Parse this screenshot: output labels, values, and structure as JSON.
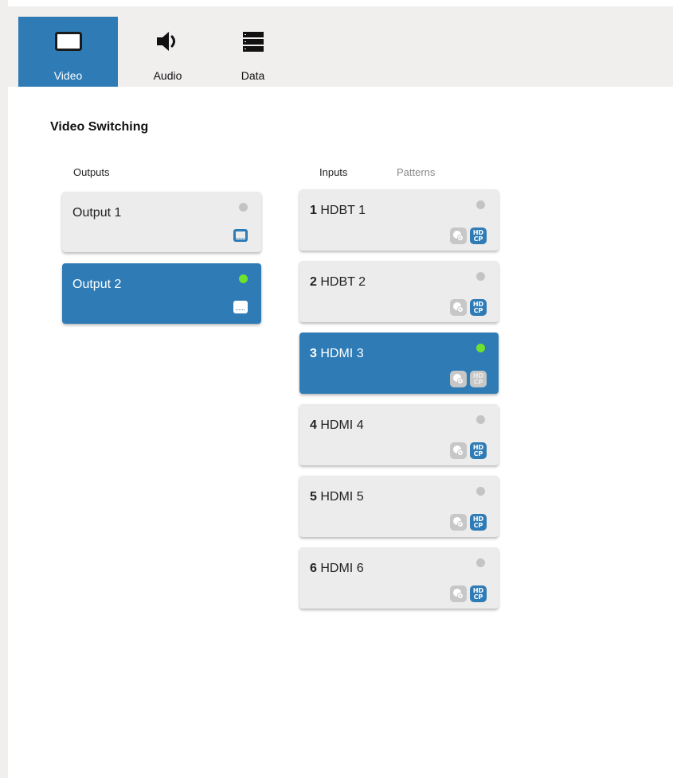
{
  "tabs": [
    {
      "label": "Video",
      "icon": "monitor-icon",
      "active": true
    },
    {
      "label": "Audio",
      "icon": "speaker-icon",
      "active": false
    },
    {
      "label": "Data",
      "icon": "server-icon",
      "active": false
    }
  ],
  "section_title": "Video Switching",
  "outputs_header": "Outputs",
  "inputs_header": "Inputs",
  "patterns_header": "Patterns",
  "outputs": [
    {
      "label": "Output 1",
      "signal": false,
      "selected": false
    },
    {
      "label": "Output 2",
      "signal": true,
      "selected": true
    }
  ],
  "inputs": [
    {
      "num": "1",
      "name": "HDBT 1",
      "signal": false,
      "selected": false
    },
    {
      "num": "2",
      "name": "HDBT 2",
      "signal": false,
      "selected": false
    },
    {
      "num": "3",
      "name": "HDMI 3",
      "signal": true,
      "selected": true
    },
    {
      "num": "4",
      "name": "HDMI 4",
      "signal": false,
      "selected": false
    },
    {
      "num": "5",
      "name": "HDMI 5",
      "signal": false,
      "selected": false
    },
    {
      "num": "6",
      "name": "HDMI 6",
      "signal": false,
      "selected": false
    }
  ],
  "hdcp_badge_text": [
    "HD",
    "CP"
  ],
  "colors": {
    "accent": "#2e7bb6",
    "signal_on": "#6fe12e",
    "signal_off": "#c4c4c4",
    "card_bg": "#ececec",
    "bar_bg": "#f1eeee"
  }
}
